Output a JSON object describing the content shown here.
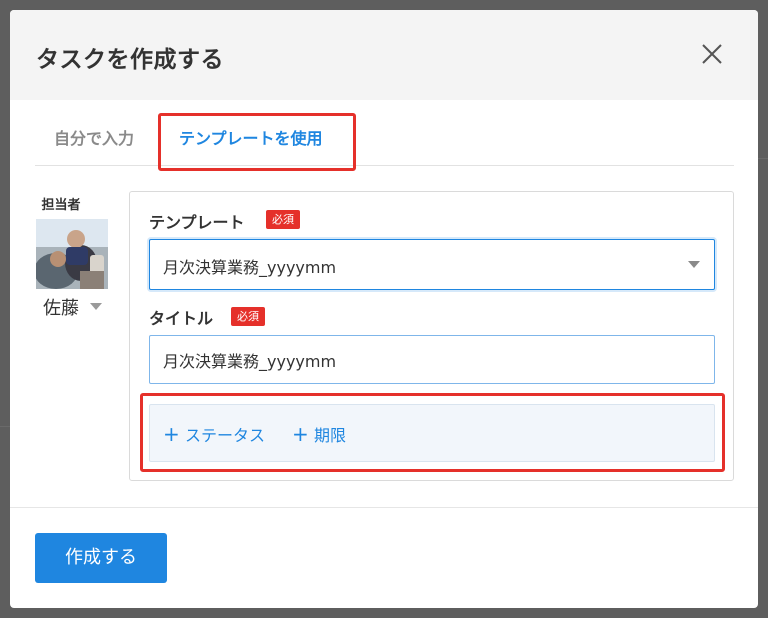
{
  "modal": {
    "title": "タスクを作成する"
  },
  "tabs": [
    {
      "label": "自分で入力",
      "active": false
    },
    {
      "label": "テンプレートを使用",
      "active": true
    }
  ],
  "assignee": {
    "label": "担当者",
    "name": "佐藤"
  },
  "form": {
    "template": {
      "label": "テンプレート",
      "required_badge": "必須",
      "value": "月次決算業務_yyyymm"
    },
    "title": {
      "label": "タイトル",
      "required_badge": "必須",
      "value": "月次決算業務_yyyymm"
    },
    "options": [
      {
        "plus": "+",
        "label": "ステータス"
      },
      {
        "plus": "+",
        "label": "期限"
      }
    ]
  },
  "footer": {
    "create_label": "作成する"
  },
  "colors": {
    "accent": "#1f86e0",
    "highlight": "#e5302a",
    "required": "#e5302a"
  }
}
